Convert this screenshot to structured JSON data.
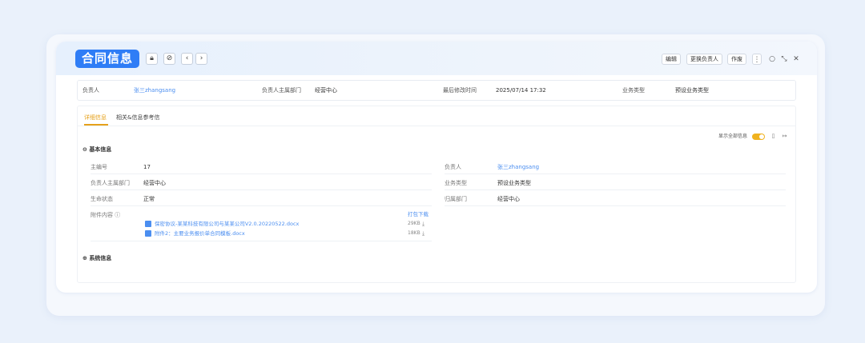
{
  "header": {
    "title": "合同信息",
    "icons": {
      "lock": "lock-icon",
      "tag": "tag-icon",
      "prev": "chevron-left-icon",
      "next": "chevron-right-icon"
    },
    "buttons": {
      "edit": "编辑",
      "change_owner": "更换负责人",
      "void": "作废"
    },
    "right_icons": {
      "more": "more-vertical-icon",
      "refresh": "refresh-icon",
      "expand": "expand-icon",
      "close": "close-icon"
    }
  },
  "summary": {
    "owner_label": "负责人",
    "owner_value": "张三zhangsang",
    "dept_label": "负责人主属部门",
    "dept_value": "经营中心",
    "modified_label": "最后修改时间",
    "modified_value": "2025/07/14 17:32",
    "biztype_label": "业务类型",
    "biztype_value": "预设业务类型"
  },
  "tabs": [
    {
      "label": "详细信息",
      "active": true
    },
    {
      "label": "相关&信息参考信",
      "active": false
    }
  ],
  "toggle": {
    "label": "显示全部信息",
    "on": true
  },
  "basic_section": {
    "title": "基本信息",
    "fields": {
      "main_no_label": "主编号",
      "main_no_value": "17",
      "owner_label": "负责人",
      "owner_value": "张三zhangsang",
      "dept_label": "负责人主属部门",
      "dept_value": "经营中心",
      "biztype_label": "业务类型",
      "biztype_value": "预设业务类型",
      "status_label": "生命状态",
      "status_value": "正常",
      "belong_dept_label": "归属部门",
      "belong_dept_value": "经营中心",
      "attachment_label": "附件内容"
    },
    "pack_download": "打包下载",
    "files": [
      {
        "name": "保密协议-某某科技有限公司与某某公司V2.0.20220522.docx",
        "size": "29KB"
      },
      {
        "name": "附件2：主要业务报价单合同模板.docx",
        "size": "18KB"
      }
    ]
  },
  "system_section": {
    "title": "系统信息"
  }
}
